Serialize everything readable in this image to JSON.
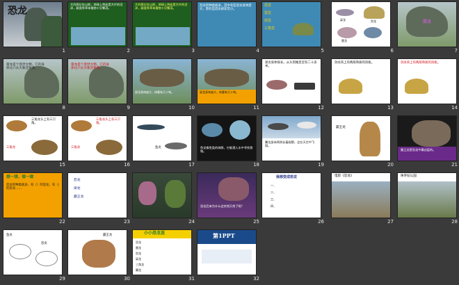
{
  "window": {
    "title": "恐龙"
  },
  "colors": {
    "bg": "#3a3a3a",
    "sea": "#3f8ab5",
    "orange": "#f2a100",
    "purple": "#6a2a8a",
    "red": "#d0141c",
    "green": "#2c7a2c",
    "yellow": "#f5d000"
  },
  "slides": [
    {
      "n": "1",
      "title": "恐龙"
    },
    {
      "n": "2",
      "text": "大约两亿年以前，地球上到处是大片的沼泽，蕨类等草本植物十分繁茂。"
    },
    {
      "n": "3",
      "text": "大约两亿年以前，地球上到处是大片的沼泽，蕨类等草本植物十分繁茂。"
    },
    {
      "n": "4",
      "text": "恐龙的种类很多，其中有些恐龙身体庞大，而有些恐龙却非常小。"
    },
    {
      "n": "5",
      "labels": [
        "恐龙",
        "雷龙",
        "剑龙",
        "三角龙"
      ]
    },
    {
      "n": "6",
      "labels": [
        "剑龙",
        "梁龙",
        "雷龙"
      ]
    },
    {
      "n": "7",
      "labels": [
        "梁龙"
      ]
    },
    {
      "n": "8",
      "text": "雷龙是个庞然大物，它的身体比六头大象还要重。"
    },
    {
      "n": "9",
      "text": "雷龙是个庞然大物，它的身体比六头大象还要重。"
    },
    {
      "n": "10",
      "text": "梁龙身体庞大，体重有几十吨。"
    },
    {
      "n": "11",
      "text": "梁龙身体庞大，体重有几十吨。"
    },
    {
      "n": "12",
      "text": "梁龙身体很长，从头到尾足足有二十多米。"
    },
    {
      "n": "13",
      "text": "剑龙背上有两排骨质的剑板。"
    },
    {
      "n": "14",
      "text": "剑龙背上有两排骨质的剑板。"
    },
    {
      "n": "15",
      "text": "三角龙头上有三只角。",
      "label": "三角龙"
    },
    {
      "n": "16",
      "text": "三角龙头上有三只角。",
      "label": "三角龙"
    },
    {
      "n": "17",
      "label": "鱼龙"
    },
    {
      "n": "18",
      "text": "鱼龙像鱼类的海豚，它能潜入水中寻找食物。"
    },
    {
      "n": "19",
      "text": "翼龙身体两侧长着翅膀，会在天空中飞翔。"
    },
    {
      "n": "20",
      "label": "霸王龙"
    },
    {
      "n": "21",
      "text": "霸王龙是恐龙中最凶猛的。"
    },
    {
      "n": "22",
      "title": "想一想，做一做",
      "text": "恐龙的种类很多，有（）的恐龙，有（）的恐龙……"
    },
    {
      "n": "23",
      "lines": [
        "恐龙",
        "梁龙",
        "霸王龙"
      ]
    },
    {
      "n": "24"
    },
    {
      "n": "25",
      "text": "恐龙后来为什么会突然灭绝了呢？"
    },
    {
      "n": "26",
      "title": "我想变成恐龙",
      "lines": [
        "一、",
        "二、",
        "三、",
        "四、"
      ]
    },
    {
      "n": "27",
      "title": "电影《恐龙》"
    },
    {
      "n": "28",
      "title": "侏罗纪公园"
    },
    {
      "n": "29",
      "labels": [
        "鱼龙",
        "恐龙"
      ]
    },
    {
      "n": "30",
      "labels": [
        "霸王龙"
      ]
    },
    {
      "n": "31",
      "title": "小小恐龙迷",
      "rows": [
        "恐龙",
        "雷龙",
        "剑龙",
        "梁龙",
        "三角龙",
        "翼龙"
      ]
    },
    {
      "n": "32",
      "title": "第1PPT"
    }
  ]
}
